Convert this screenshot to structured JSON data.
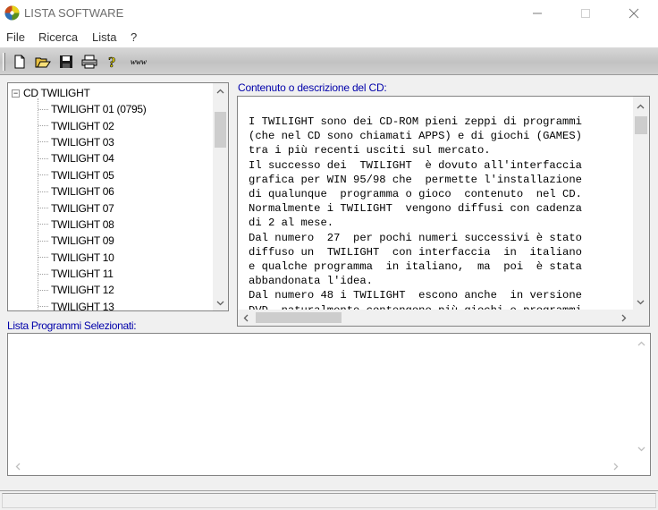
{
  "window": {
    "title": "LISTA SOFTWARE"
  },
  "menu": {
    "items": [
      {
        "label": "File"
      },
      {
        "label": "Ricerca"
      },
      {
        "label": "Lista"
      },
      {
        "label": "?"
      }
    ]
  },
  "toolbar": {
    "buttons": [
      {
        "icon": "new-document-icon"
      },
      {
        "icon": "open-folder-icon"
      },
      {
        "icon": "save-disk-icon"
      },
      {
        "icon": "printer-icon"
      },
      {
        "icon": "help-question-icon"
      },
      {
        "icon": "www-icon",
        "label": "www"
      }
    ]
  },
  "tree": {
    "root": {
      "label": "CD TWILIGHT",
      "toggle": "−"
    },
    "children": [
      {
        "label": "TWILIGHT 01 (0795)"
      },
      {
        "label": "TWILIGHT 02"
      },
      {
        "label": "TWILIGHT 03"
      },
      {
        "label": "TWILIGHT 04"
      },
      {
        "label": "TWILIGHT 05"
      },
      {
        "label": "TWILIGHT 06"
      },
      {
        "label": "TWILIGHT 07"
      },
      {
        "label": "TWILIGHT 08"
      },
      {
        "label": "TWILIGHT 09"
      },
      {
        "label": "TWILIGHT 10"
      },
      {
        "label": "TWILIGHT 11"
      },
      {
        "label": "TWILIGHT 12"
      },
      {
        "label": "TWILIGHT 13"
      }
    ]
  },
  "description": {
    "label": "Contenuto o descrizione del CD:",
    "text": "I TWILIGHT sono dei CD-ROM pieni zeppi di programmi\n(che nel CD sono chiamati APPS) e di giochi (GAMES)\ntra i più recenti usciti sul mercato.\nIl successo dei  TWILIGHT  è dovuto all'interfaccia\ngrafica per WIN 95/98 che  permette l'installazione\ndi qualunque  programma o gioco  contenuto  nel CD.\nNormalmente i TWILIGHT  vengono diffusi con cadenza\ndi 2 al mese.\nDal numero  27  per pochi numeri successivi è stato\ndiffuso un  TWILIGHT  con interfaccia  in  italiano\ne qualche programma  in italiano,  ma  poi  è stata\nabbandonata l'idea.\nDal numero 48 i TWILIGHT  escono anche  in versione\nDVD, naturalmente contengono più giochi e programmi"
  },
  "selected": {
    "label": "Lista Programmi Selezionati:"
  }
}
